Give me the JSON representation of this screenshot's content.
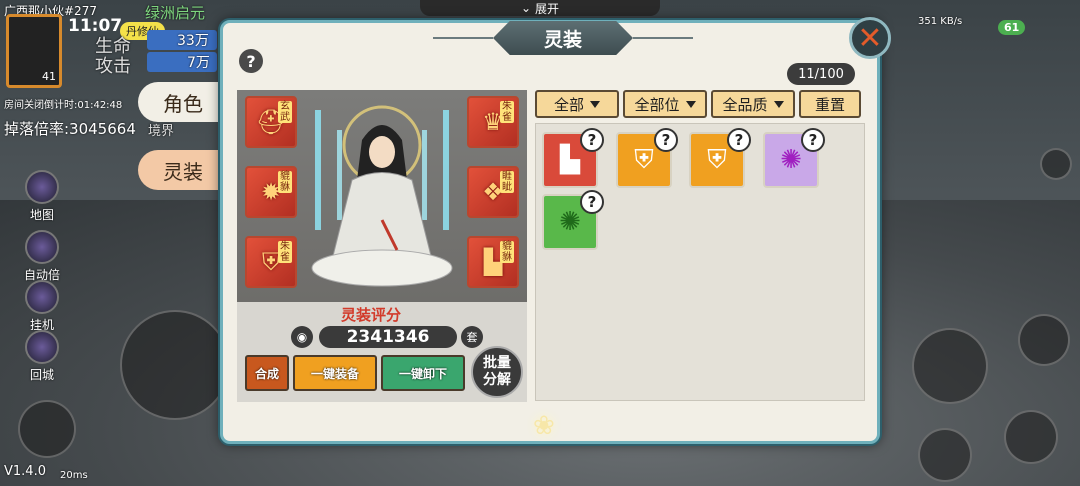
{
  "hud": {
    "room_name": "广西那小伙#277",
    "time": "11:07",
    "stat_life_label": "生命",
    "stat_attack_label": "攻击",
    "life_value": "33万",
    "attack_value": "7万",
    "room_close_timer": "房间关闭倒计时:01:42:48",
    "drop_rate": "掉落倍率:3045664",
    "realm_label": "境界",
    "expand_label": "展开",
    "version": "V1.4.0",
    "ping": "20ms",
    "network_speed": "351 KB/s",
    "battery": "61",
    "top_banner": "绿洲启元",
    "buff_label": "丹修仙"
  },
  "sidebar_tabs": [
    {
      "label": "角色"
    },
    {
      "label": "灵装"
    }
  ],
  "left_icons": [
    {
      "label": "地图"
    },
    {
      "label": "自动倍率"
    },
    {
      "label": "挂机"
    },
    {
      "label": "回城"
    }
  ],
  "panel": {
    "title": "灵装",
    "help": "?",
    "close": "✕",
    "capacity": "11/100"
  },
  "slots": [
    {
      "tag": "玄武",
      "icon": "helmet-icon"
    },
    {
      "tag": "朱雀",
      "icon": "cap-icon"
    },
    {
      "tag": "貔貅",
      "icon": "sun-emblem-icon"
    },
    {
      "tag": "睚眦",
      "icon": "robe-icon"
    },
    {
      "tag": "朱雀",
      "icon": "armor-icon"
    },
    {
      "tag": "貔貅",
      "icon": "boot-icon"
    }
  ],
  "score": {
    "title": "灵装评分",
    "value": "2341346",
    "set_label": "套"
  },
  "actions": {
    "combine": "合成",
    "equip_all": "一键装备",
    "unequip_all": "一键卸下",
    "batch_decompose": "批量分解"
  },
  "filters": [
    {
      "label": "全部",
      "dropdown": true
    },
    {
      "label": "全部位",
      "dropdown": true
    },
    {
      "label": "全品质",
      "dropdown": true
    },
    {
      "label": "重置",
      "dropdown": false
    }
  ],
  "inventory": [
    {
      "icon": "boot-icon",
      "color": "#d94a3a",
      "q": "?"
    },
    {
      "icon": "armor-icon",
      "color": "#f0a020",
      "q": "?"
    },
    {
      "icon": "armor-icon",
      "color": "#f0a020",
      "q": "?"
    },
    {
      "icon": "gem-icon",
      "color": "#c9a8e8",
      "q": "?"
    },
    {
      "icon": "gem-icon",
      "color": "#59b84a",
      "q": "?"
    }
  ]
}
